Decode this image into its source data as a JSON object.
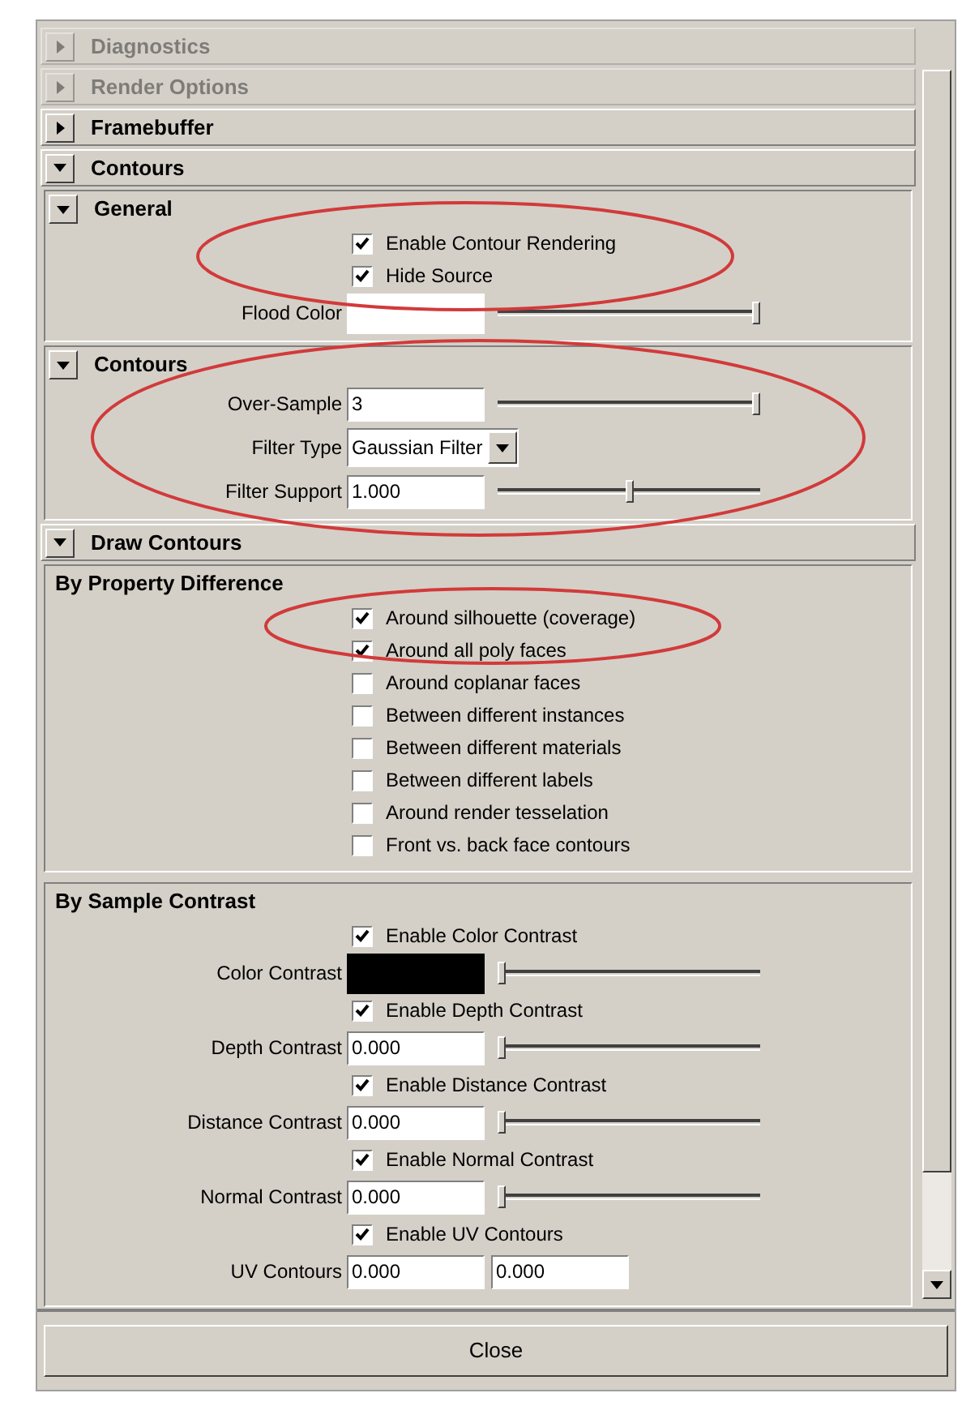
{
  "sections": [
    {
      "title": "Diagnostics",
      "expanded": false,
      "faded": true
    },
    {
      "title": "Render Options",
      "expanded": false,
      "faded": true
    },
    {
      "title": "Framebuffer",
      "expanded": false,
      "faded": false
    },
    {
      "title": "Contours",
      "expanded": true,
      "faded": false,
      "groups": [
        {
          "title": "General",
          "expanded": true,
          "rows": [
            {
              "kind": "checkbox",
              "label": "Enable Contour Rendering",
              "checked": true
            },
            {
              "kind": "checkbox",
              "label": "Hide Source",
              "checked": true
            },
            {
              "kind": "color",
              "label": "Flood Color",
              "color": "#ffffff",
              "level": 1
            }
          ]
        },
        {
          "title": "Contours",
          "expanded": true,
          "rows": [
            {
              "kind": "number",
              "label": "Over-Sample",
              "value": "3",
              "level": 1
            },
            {
              "kind": "dropdown",
              "label": "Filter Type",
              "value": "Gaussian Filter"
            },
            {
              "kind": "number",
              "label": "Filter Support",
              "value": "1.000",
              "level": 0.5
            }
          ]
        }
      ]
    },
    {
      "title": "Draw Contours",
      "expanded": true,
      "faded": false,
      "frames": [
        {
          "title": "By Property Difference",
          "rows": [
            {
              "kind": "checkbox",
              "label": "Around silhouette (coverage)",
              "checked": true
            },
            {
              "kind": "checkbox",
              "label": "Around all poly faces",
              "checked": true
            },
            {
              "kind": "checkbox",
              "label": "Around coplanar faces",
              "checked": false
            },
            {
              "kind": "checkbox",
              "label": "Between different instances",
              "checked": false
            },
            {
              "kind": "checkbox",
              "label": "Between different materials",
              "checked": false
            },
            {
              "kind": "checkbox",
              "label": "Between different labels",
              "checked": false
            },
            {
              "kind": "checkbox",
              "label": "Around render tesselation",
              "checked": false
            },
            {
              "kind": "checkbox",
              "label": "Front vs. back face contours",
              "checked": false
            }
          ]
        },
        {
          "title": "By Sample Contrast",
          "rows": [
            {
              "kind": "checkbox",
              "label": "Enable Color Contrast",
              "checked": true
            },
            {
              "kind": "color",
              "label": "Color Contrast",
              "color": "#000000",
              "level": 0
            },
            {
              "kind": "checkbox",
              "label": "Enable Depth Contrast",
              "checked": true
            },
            {
              "kind": "number",
              "label": "Depth Contrast",
              "value": "0.000",
              "level": 0
            },
            {
              "kind": "checkbox",
              "label": "Enable Distance Contrast",
              "checked": true
            },
            {
              "kind": "number",
              "label": "Distance Contrast",
              "value": "0.000",
              "level": 0
            },
            {
              "kind": "checkbox",
              "label": "Enable Normal Contrast",
              "checked": true
            },
            {
              "kind": "number",
              "label": "Normal Contrast",
              "value": "0.000",
              "level": 0
            },
            {
              "kind": "checkbox",
              "label": "Enable UV Contours",
              "checked": true
            },
            {
              "kind": "pair",
              "label": "UV Contours",
              "values": [
                "0.000",
                "0.000"
              ]
            }
          ]
        }
      ]
    }
  ],
  "close_button": "Close"
}
